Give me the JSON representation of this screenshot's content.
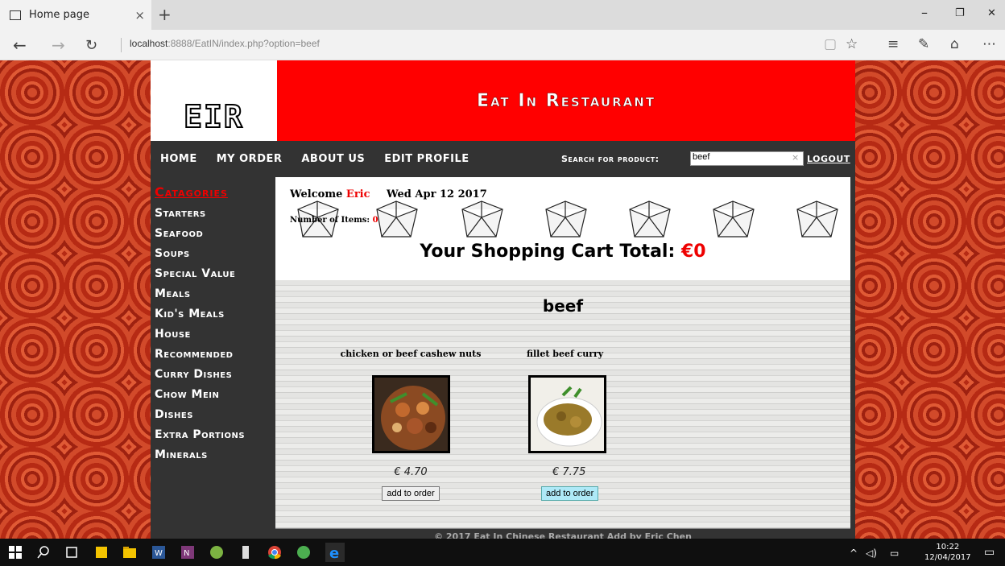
{
  "browser": {
    "tab_title": "Home page",
    "tab_close": "×",
    "new_tab": "+",
    "url_host": "localhost",
    "url_rest": ":8888/EatIN/index.php?option=beef",
    "win_min": "–",
    "win_restore": "❐",
    "win_close": "✕"
  },
  "site": {
    "logo": "EIR",
    "banner": "Eat In Restaurant",
    "menu": [
      "HOME",
      "MY ORDER",
      "ABOUT US",
      "EDIT PROFILE"
    ],
    "search_label": "Search for product:",
    "search_value": "beef",
    "logout": "LOGOUT"
  },
  "sidebar": {
    "title": "Catagories",
    "items": [
      "Starters",
      "Seafood",
      "Soups",
      "Special Value",
      "Meals",
      "Kid's Meals",
      "House",
      "Recommended",
      "Curry Dishes",
      "Chow Mein",
      "Dishes",
      "Extra Portions",
      "Minerals"
    ]
  },
  "cart": {
    "welcome": "Welcome",
    "user": "Eric",
    "date": "Wed Apr 12 2017",
    "items_label": "Number of Items:",
    "items_count": "0",
    "total_label": "Your Shopping Cart Total:",
    "total_value": "€0"
  },
  "results": {
    "heading": "beef",
    "products": [
      {
        "name": "chicken or beef cashew nuts",
        "price": "€ 4.70",
        "button": "add to order"
      },
      {
        "name": "fillet beef curry",
        "price": "€ 7.75",
        "button": "add to order"
      }
    ]
  },
  "footer": "© 2017 Eat In Chinese Restaurant   Add by Eric Chen",
  "taskbar": {
    "time": "10:22",
    "date": "12/04/2017"
  },
  "colors": {
    "banner": "#ff0000",
    "accent": "#ee0000",
    "dark": "#333333"
  }
}
